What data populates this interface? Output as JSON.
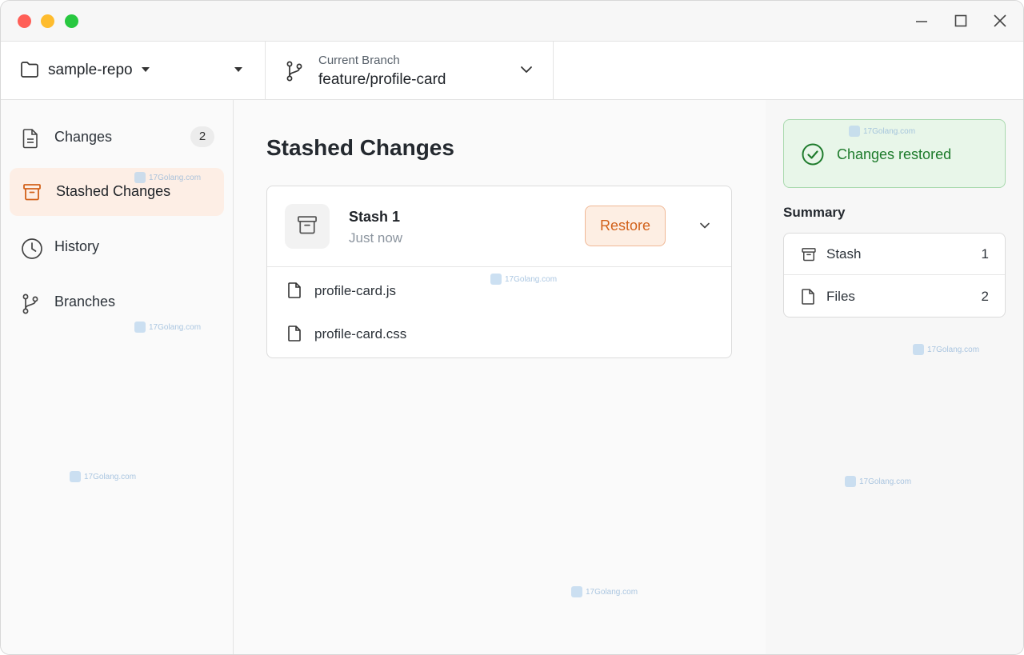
{
  "toolbar": {
    "repo_name": "sample-repo",
    "branch_caption": "Current Branch",
    "branch_name": "feature/profile-card"
  },
  "sidebar": {
    "items": [
      {
        "label": "Changes",
        "icon": "file-icon",
        "badge": "2"
      },
      {
        "label": "Stashed Changes",
        "icon": "archive-icon",
        "active": true
      },
      {
        "label": "History",
        "icon": "clock-icon"
      },
      {
        "label": "Branches",
        "icon": "branch-icon"
      }
    ]
  },
  "main": {
    "title": "Stashed Changes",
    "stash": {
      "name": "Stash 1",
      "time": "Just now",
      "restore_label": "Restore",
      "files": [
        "profile-card.js",
        "profile-card.css"
      ]
    }
  },
  "right": {
    "toast": "Changes restored",
    "summary_title": "Summary",
    "summary": [
      {
        "label": "Stash",
        "value": "1",
        "icon": "archive-icon"
      },
      {
        "label": "Files",
        "value": "2",
        "icon": "file-icon"
      }
    ]
  },
  "watermark": "17Golang.com",
  "colors": {
    "accent": "#d2611a",
    "active_bg": "#fdeee5",
    "success": "#1e7b2c",
    "success_bg": "#e8f6e9"
  }
}
